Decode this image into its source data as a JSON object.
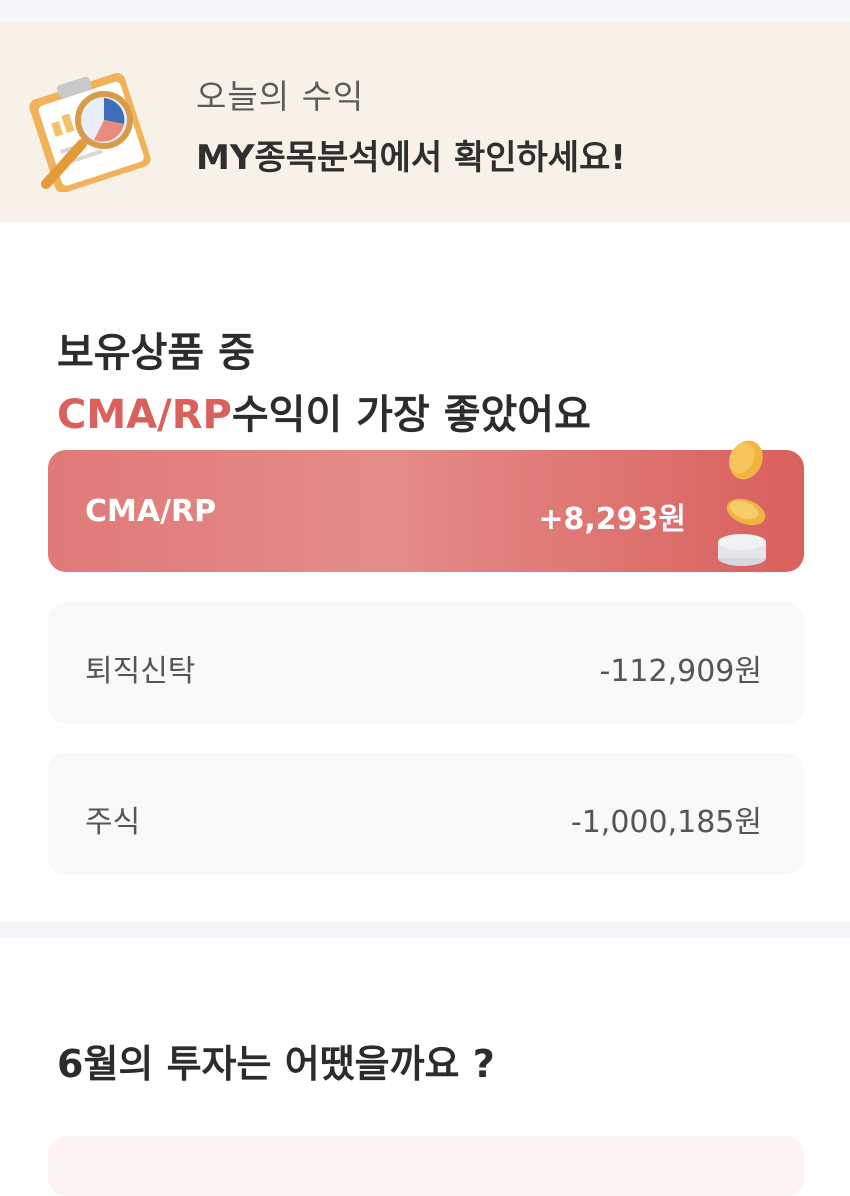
{
  "banner": {
    "subtitle": "오늘의 수익",
    "title": "MY종목분석에서 확인하세요!"
  },
  "best": {
    "headline_line1": "보유상품 중",
    "headline_accent": "CMA/RP",
    "headline_rest": "수익이 가장 좋았어요"
  },
  "products": [
    {
      "name": "CMA/RP",
      "value": "+8,293원"
    },
    {
      "name": "퇴직신탁",
      "value": "-112,909원"
    },
    {
      "name": "주식",
      "value": "-1,000,185원"
    }
  ],
  "monthly": {
    "headline": "6월의 투자는 어땠을까요 ?"
  },
  "colors": {
    "accent": "#d9605d",
    "banner_bg": "#f8f1e8",
    "card_bg": "#f8f9fb"
  }
}
